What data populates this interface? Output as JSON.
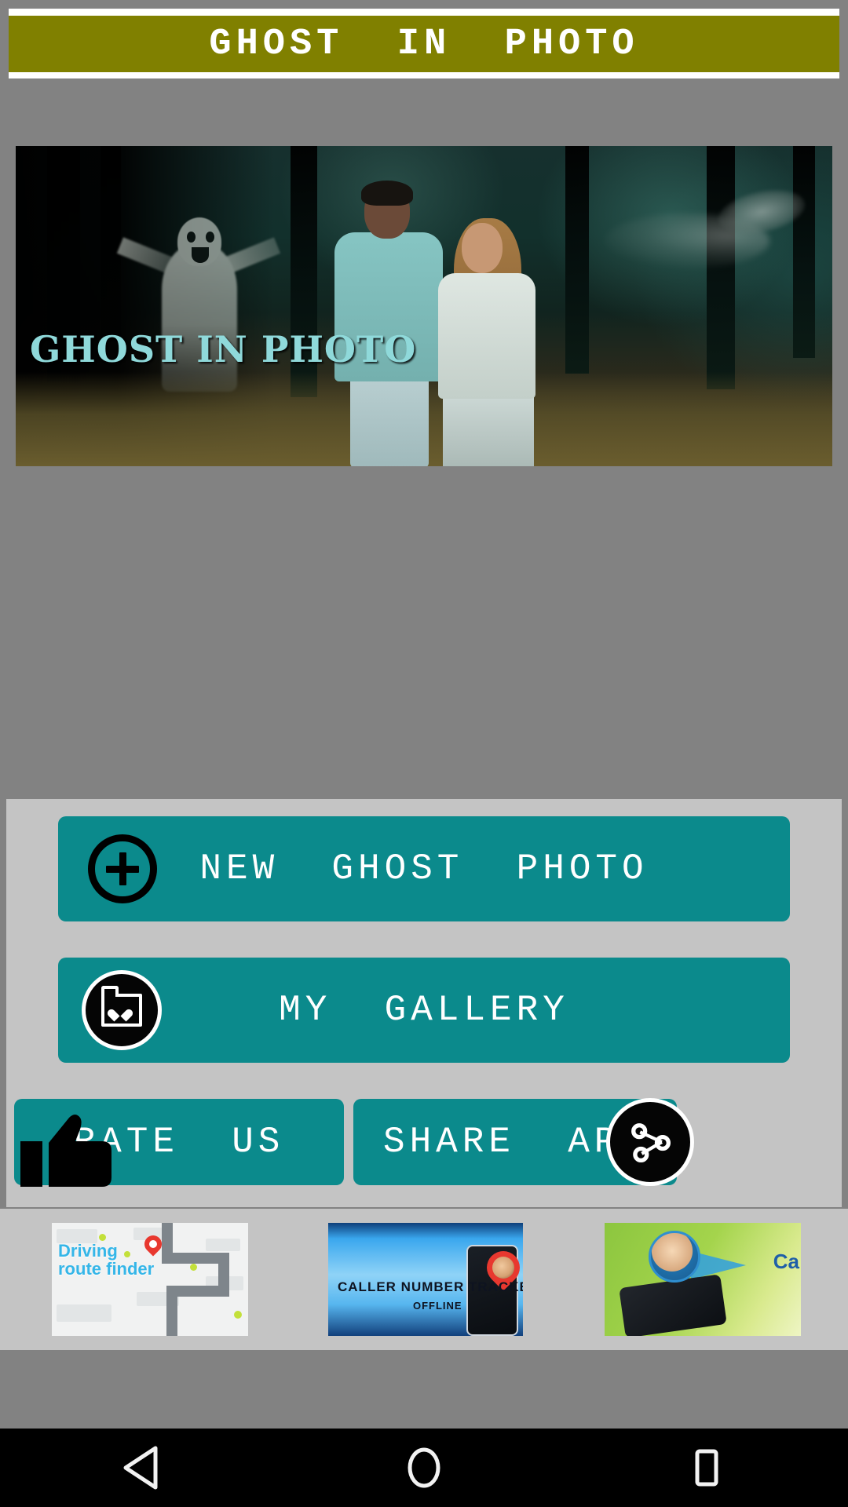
{
  "app": {
    "header_title": "GHOST  IN  PHOTO",
    "accent_teal": "#0b8a8c",
    "header_olive": "#808000",
    "panel_grey": "#c4c4c4",
    "page_grey": "#828282"
  },
  "preview": {
    "watermark": "GHOST IN PHOTO",
    "watermark_color": "#8fd9da",
    "scene_alt": "couple-in-forest-with-ghosts"
  },
  "actions": {
    "new_photo": {
      "label": "NEW  GHOST  PHOTO",
      "icon": "plus-circle-icon"
    },
    "my_gallery": {
      "label": "MY  GALLERY",
      "icon": "folder-heart-icon"
    },
    "rate_us": {
      "label": "RATE  US",
      "icon": "thumbs-up-icon"
    },
    "share_app": {
      "label": "SHARE  APP",
      "icon": "share-nodes-icon"
    }
  },
  "ads": [
    {
      "title_line1": "Driving",
      "title_line2": "route finder",
      "accent": "#35b6e8"
    },
    {
      "title": "CALLER NUMBER TRACKER",
      "subtitle": "OFFLINE",
      "accent": "#0e1320"
    },
    {
      "title": "Ca",
      "accent": "#1f5fa8"
    }
  ],
  "navbar": {
    "back": "back-button",
    "home": "home-button",
    "recents": "recents-button"
  }
}
